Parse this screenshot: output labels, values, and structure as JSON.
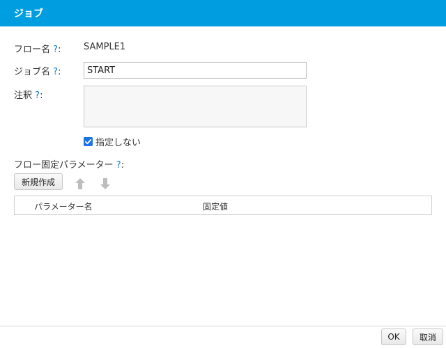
{
  "dialog": {
    "title": "ジョブ"
  },
  "help_mark": "?",
  "form": {
    "flow_name_label": "フロー名",
    "flow_name_value": "SAMPLE1",
    "job_name_label": "ジョブ名",
    "job_name_value": "START",
    "note_label": "注釈",
    "note_value": "",
    "unspecified_label": "指定しない",
    "unspecified_checked": true
  },
  "params": {
    "section_label": "フロー固定パラメーター",
    "new_button": "新規作成",
    "columns": [
      "パラメーター名",
      "固定値"
    ],
    "rows": []
  },
  "footer": {
    "ok": "OK",
    "cancel": "取消"
  },
  "colors": {
    "titlebar": "#009ee0",
    "help": "#1a7bc8",
    "checkbox": "#1a73e8"
  }
}
